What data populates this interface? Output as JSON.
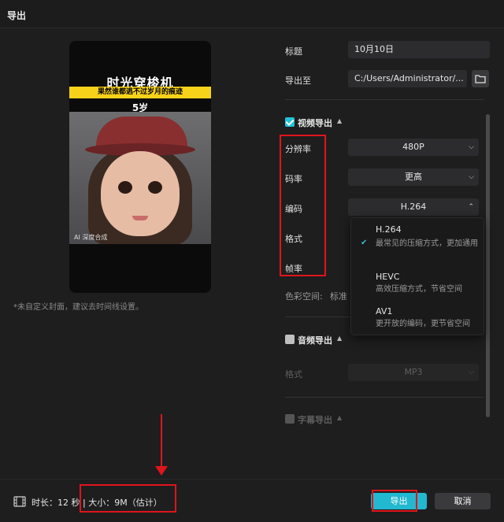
{
  "window": {
    "title": "导出"
  },
  "preview": {
    "headline": "时光穿梭机",
    "banner": "果然谁都逃不过岁月的痕迹",
    "age": "5岁",
    "watermark": "AI 深度合成",
    "cover_hint": "*未自定义封面，建议去时间线设置。"
  },
  "form": {
    "title_label": "标题",
    "title_value": "10月10日",
    "export_to_label": "导出至",
    "export_to_value": "C:/Users/Administrator/...",
    "folder_icon": "folder-icon"
  },
  "video": {
    "section_label": "视频导出",
    "checked": true,
    "resolution_label": "分辨率",
    "resolution_value": "480P",
    "bitrate_label": "码率",
    "bitrate_value": "更高",
    "codec_label": "编码",
    "codec_value": "H.264",
    "format_label": "格式",
    "framerate_label": "帧率",
    "colorspace_label": "色彩空间:",
    "colorspace_value": "标准"
  },
  "codec_dropdown": {
    "options": [
      {
        "name": "H.264",
        "desc": "最常见的压缩方式，更加通用",
        "selected": true
      },
      {
        "name": "HEVC",
        "desc": "高效压缩方式，节省空间",
        "selected": false
      },
      {
        "name": "AV1",
        "desc": "更开放的编码，更节省空间",
        "selected": false
      }
    ]
  },
  "audio": {
    "section_label": "音频导出",
    "checked": false,
    "format_label": "格式",
    "format_value": "MP3"
  },
  "subtitle": {
    "section_label": "字幕导出",
    "checked": false
  },
  "footer": {
    "duration": "时长：12 秒",
    "divider": "|",
    "size": "大小：9M（估计）",
    "export_button": "导出",
    "cancel_button": "取消"
  },
  "colors": {
    "accent": "#22b8cf",
    "annotation": "#e0141b",
    "background": "#1e1e1f"
  }
}
